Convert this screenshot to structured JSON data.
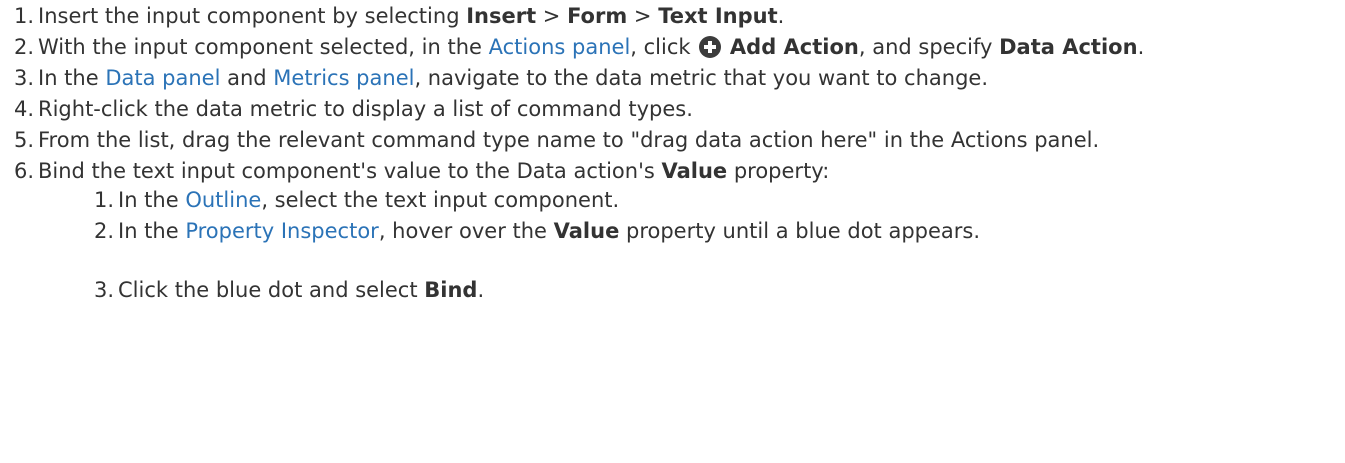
{
  "steps": [
    {
      "num": "1.",
      "text_a": "Insert the input component by selecting ",
      "b1": "Insert",
      "sep1": " > ",
      "b2": "Form",
      "sep2": " > ",
      "b3": "Text Input",
      "end": "."
    },
    {
      "num": "2.",
      "text_a": "With the input component selected, in the ",
      "link1": "Actions panel",
      "text_b": ", click ",
      "icon": "plus-circle-icon",
      "b1": "Add Action",
      "text_c": ", and specify ",
      "b2": "Data Action",
      "end": "."
    },
    {
      "num": "3.",
      "text_a": "In the ",
      "link1": "Data panel",
      "text_b": " and ",
      "link2": "Metrics panel",
      "text_c": ", navigate to the data metric that you want to change."
    },
    {
      "num": "4.",
      "text_a": "Right-click the data metric to display a list of command types."
    },
    {
      "num": "5.",
      "text_a": "From the list, drag the relevant command type name to \"drag data action here\" in the Actions panel."
    },
    {
      "num": "6.",
      "text_a": "Bind the text input component's value to the Data action's ",
      "b1": "Value",
      "text_b": " property:",
      "substeps": [
        {
          "num": "1.",
          "text_a": "In the ",
          "link1": "Outline",
          "text_b": ", select the text input component."
        },
        {
          "num": "2.",
          "text_a": "In the ",
          "link1": "Property Inspector",
          "text_b": ", hover over the ",
          "b1": "Value",
          "text_c": " property until a blue dot appears."
        },
        {
          "num": "3.",
          "text_a": "Click the blue dot and select ",
          "b1": "Bind",
          "end": "."
        }
      ]
    }
  ],
  "colors": {
    "text": "#333333",
    "link": "#2b73b7"
  }
}
